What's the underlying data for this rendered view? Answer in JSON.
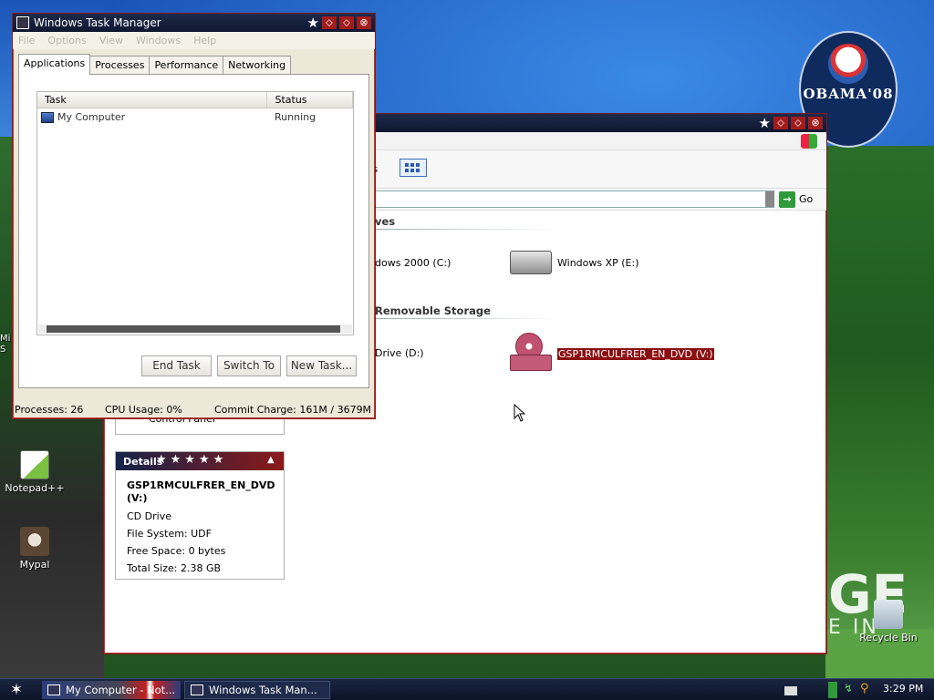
{
  "desktop": {
    "icons": [
      {
        "label": "Notepad++",
        "icon": "notepadpp-icon"
      },
      {
        "label": "Mypal",
        "icon": "mypal-icon"
      },
      {
        "label": "Recycle Bin",
        "icon": "recycle-bin-icon"
      }
    ],
    "edge_label_left": "Mi S",
    "badge": {
      "text": "OBAMA'08"
    },
    "wallpaper_word": "GE",
    "wallpaper_word2": "E IN"
  },
  "explorer": {
    "toolbar_folders": "rs",
    "address_go": "Go",
    "sections": {
      "drives_partial": "ves",
      "removable": "Removable Storage"
    },
    "drives": [
      {
        "label": "dows 2000 (C:)",
        "icon": "hard-drive-icon"
      },
      {
        "label": "Windows XP (E:)",
        "icon": "hard-drive-icon"
      },
      {
        "label": "Drive (D:)",
        "icon": "cd-drive-icon"
      },
      {
        "label": "GSP1RMCULFRER_EN_DVD (V:)",
        "icon": "dvd-drive-icon",
        "selected": true
      }
    ],
    "control_panel_stub": "Control Panel",
    "details": {
      "title": "Details",
      "name": "GSP1RMCULFRER_EN_DVD (V:)",
      "type": "CD Drive",
      "file_system": "File System: UDF",
      "free_space": "Free Space: 0 bytes",
      "total_size": "Total Size: 2.38 GB"
    }
  },
  "taskmgr": {
    "title": "Windows Task Manager",
    "menu": [
      "File",
      "Options",
      "View",
      "Windows",
      "Help"
    ],
    "tabs": [
      "Applications",
      "Processes",
      "Performance",
      "Networking"
    ],
    "active_tab": "Applications",
    "columns": {
      "task": "Task",
      "status": "Status"
    },
    "rows": [
      {
        "task": "My Computer",
        "status": "Running"
      }
    ],
    "buttons": {
      "end_task": "End Task",
      "switch_to": "Switch To",
      "new_task": "New Task..."
    },
    "status": {
      "processes": "Processes: 26",
      "cpu": "CPU Usage: 0%",
      "commit": "Commit Charge: 161M / 3679M"
    }
  },
  "taskbar": {
    "buttons": [
      {
        "label": "My Computer - Not..."
      },
      {
        "label": "Windows Task Man..."
      }
    ],
    "clock": "3:29 PM"
  },
  "colors": {
    "title_bar": "#0f1730",
    "accent_red": "#a11c1c",
    "selection": "#8b0f12"
  }
}
